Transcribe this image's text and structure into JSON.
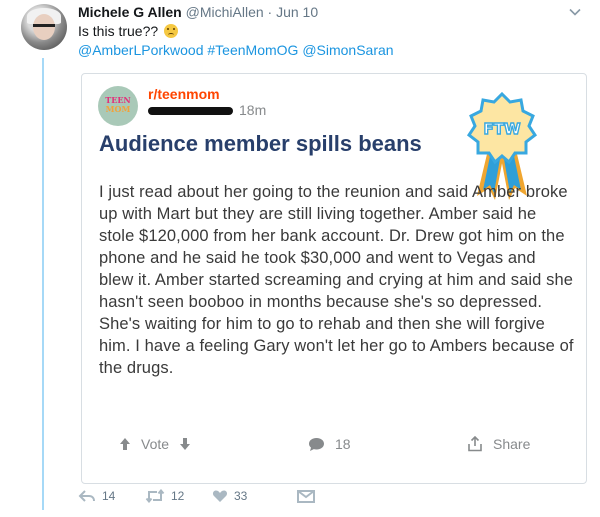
{
  "tweet": {
    "author_name": "Michele G Allen",
    "author_handle": "@MichiAllen",
    "separator": "·",
    "time": "Jun 10",
    "text": "Is this true??",
    "emoji_icon": "worried-face-icon",
    "mentions": [
      "@AmberLPorkwood",
      "#TeenMomOG",
      "@SimonSaran"
    ]
  },
  "card": {
    "subreddit": "r/teenmom",
    "logo_text": [
      "TEEN",
      "MOM"
    ],
    "post_time": "18m",
    "title": "Audience member spills beans",
    "badge_text": "FTW",
    "body": "I just read about her going to the reunion and said Amber broke up with Mart but they are still living together. Amber said he stole $120,000 from her bank account. Dr. Drew got him on the phone and he said he took $30,000 and went to Vegas and blew it. Amber started screaming and crying at him and said she hasn't seen booboo in months because she's so depressed. She's waiting for him to go to rehab and then she will forgive him. I have a feeling Gary won't let her go to Ambers because of the drugs.",
    "actions": {
      "vote_label": "Vote",
      "comments_count": "18",
      "share_label": "Share"
    }
  },
  "tweet_actions": {
    "replies": "14",
    "retweets": "12",
    "likes": "33"
  },
  "colors": {
    "link": "#1b95e0",
    "subreddit": "#ff4500",
    "title": "#283f6b",
    "thread_line": "#a6d9f7"
  }
}
